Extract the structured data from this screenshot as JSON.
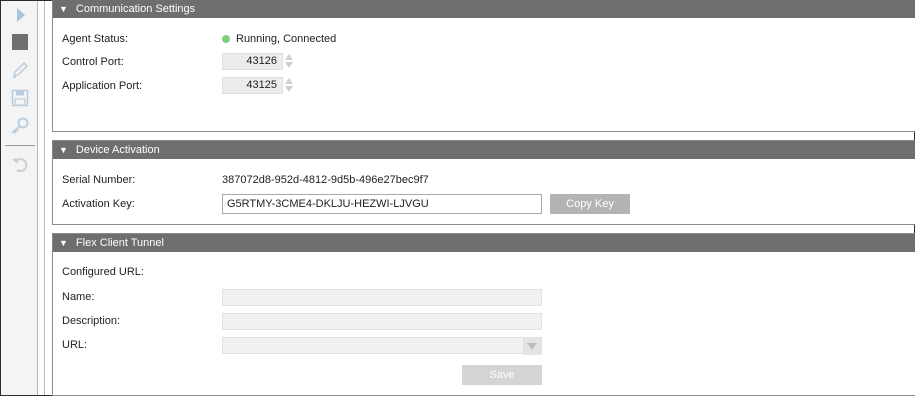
{
  "toolbar": {
    "icons": [
      "play-icon",
      "stop-icon",
      "edit-icon",
      "save-icon",
      "key-icon",
      "undo-icon"
    ]
  },
  "communication": {
    "title": "Communication Settings",
    "agent_status_label": "Agent Status:",
    "agent_status_value": "Running, Connected",
    "agent_status_color": "#7ed17e",
    "control_port_label": "Control Port:",
    "control_port_value": "43126",
    "application_port_label": "Application Port:",
    "application_port_value": "43125"
  },
  "device": {
    "title": "Device Activation",
    "serial_label": "Serial Number:",
    "serial_value": "387072d8-952d-4812-9d5b-496e27bec9f7",
    "activation_label": "Activation Key:",
    "activation_value": "G5RTMY-3CME4-DKLJU-HEZWI-LJVGU",
    "copy_button": "Copy Key"
  },
  "tunnel": {
    "title": "Flex Client Tunnel",
    "configured_url_label": "Configured URL:",
    "name_label": "Name:",
    "name_value": "",
    "description_label": "Description:",
    "description_value": "",
    "url_label": "URL:",
    "url_value": "",
    "save_button": "Save"
  }
}
